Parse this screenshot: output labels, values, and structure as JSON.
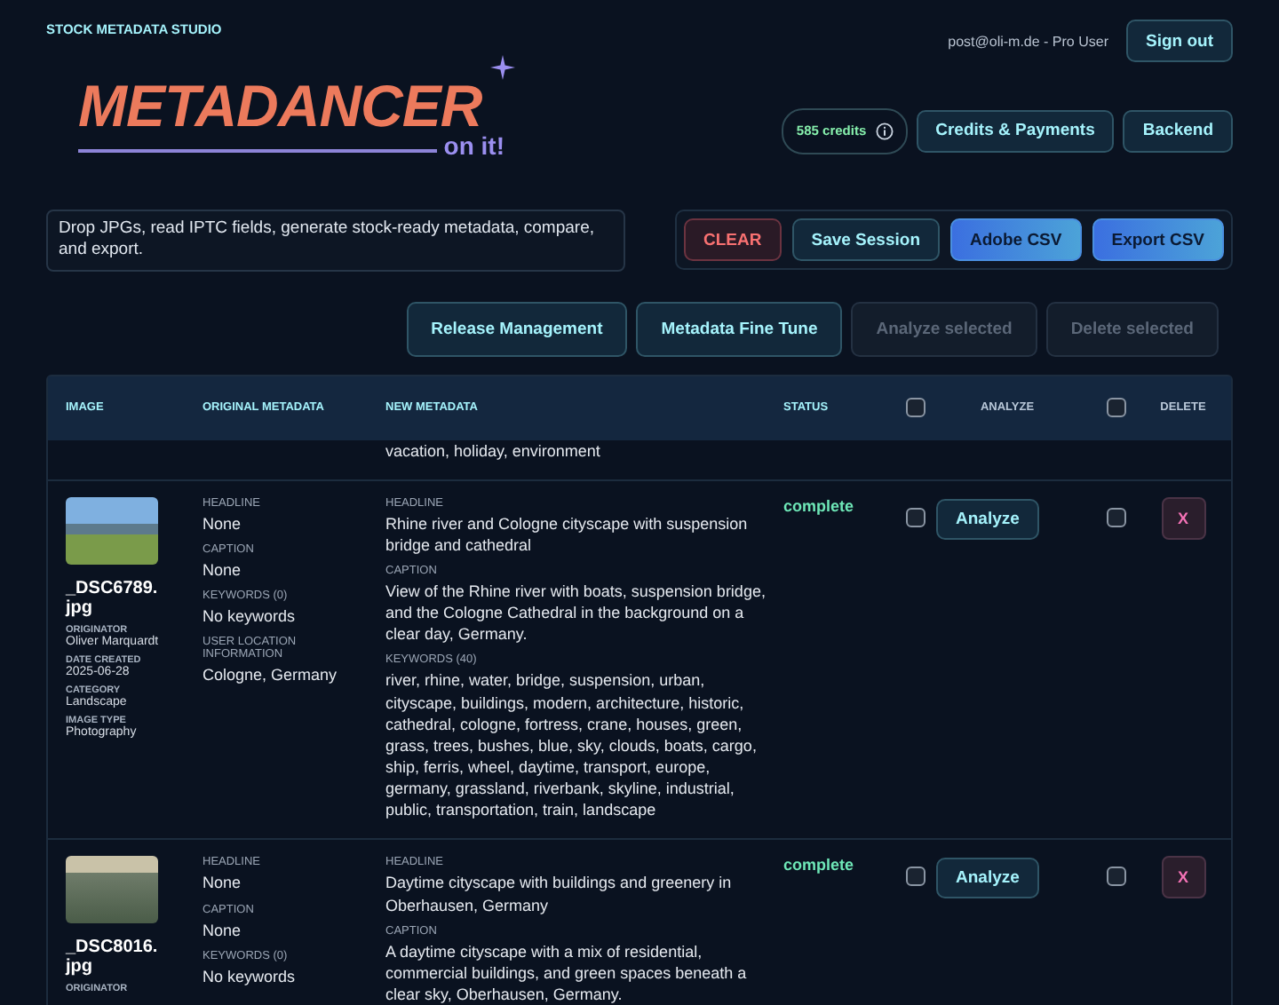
{
  "app_name": "STOCK METADATA STUDIO",
  "user": {
    "account": "post@oli-m.de - Pro User",
    "sign_out": "Sign out"
  },
  "logo": {
    "title": "METADANCER",
    "tagline": "on it!"
  },
  "credits": "585 credits",
  "nav_buttons": [
    "Credits & Payments",
    "Backend"
  ],
  "description": "Drop JPGs, read IPTC fields, generate stock-ready metadata, compare, and export.",
  "session_buttons": [
    {
      "label": "CLEAR",
      "kind": "danger"
    },
    {
      "label": "Save Session",
      "kind": "secondary"
    },
    {
      "label": "Adobe CSV",
      "kind": "primary"
    },
    {
      "label": "Export CSV",
      "kind": "primary"
    }
  ],
  "actions": [
    {
      "label": "Release Management",
      "disabled": false
    },
    {
      "label": "Metadata Fine Tune",
      "disabled": false
    },
    {
      "label": "Analyze selected",
      "disabled": true
    },
    {
      "label": "Delete selected",
      "disabled": true
    }
  ],
  "table": {
    "columns": [
      {
        "kind": "text",
        "label": "IMAGE"
      },
      {
        "kind": "text",
        "label": "ORIGINAL METADATA"
      },
      {
        "kind": "text",
        "label": "NEW METADATA"
      },
      {
        "kind": "text",
        "label": "STATUS"
      },
      {
        "kind": "checkbox",
        "checked": false
      },
      {
        "kind": "center",
        "label": "ANALYZE"
      },
      {
        "kind": "checkbox",
        "checked": false
      },
      {
        "kind": "center",
        "label": "DELETE"
      }
    ],
    "previous_row_tail": "vacation, holiday, environment",
    "rows": [
      {
        "filename": "_DSC6789.jpg",
        "image_details": [
          {
            "label": "ORIGINATOR",
            "value": "Oliver Marquardt"
          },
          {
            "label": "DATE CREATED",
            "value": "2025-06-28"
          },
          {
            "label": "CATEGORY",
            "value": "Landscape"
          },
          {
            "label": "IMAGE TYPE",
            "value": "Photography"
          }
        ],
        "original": [
          {
            "label": "HEADLINE",
            "value": "None"
          },
          {
            "label": "CAPTION",
            "value": "None"
          },
          {
            "label": "KEYWORDS (0)",
            "value": "No keywords"
          },
          {
            "label": "USER LOCATION INFORMATION",
            "value": "Cologne, Germany"
          }
        ],
        "new": [
          {
            "label": "HEADLINE",
            "value": "Rhine river and Cologne cityscape with suspension bridge and cathedral"
          },
          {
            "label": "CAPTION",
            "value": "View of the Rhine river with boats, suspension bridge, and the Cologne Cathedral in the background on a clear day, Germany."
          },
          {
            "label": "KEYWORDS (40)",
            "value": "river, rhine, water, bridge, suspension, urban, cityscape, buildings, modern, architecture, historic, cathedral, cologne, fortress, crane, houses, green, grass, trees, bushes, blue, sky, clouds, boats, cargo, ship, ferris, wheel, daytime, transport, europe, germany, grassland, riverbank, skyline, industrial, public, transportation, train, landscape"
          }
        ],
        "status": "complete",
        "analyze_checked": false,
        "analyze_label": "Analyze",
        "delete_checked": false,
        "delete_label": "X"
      },
      {
        "filename": "_DSC8016.jpg",
        "image_details": [
          {
            "label": "ORIGINATOR"
          }
        ],
        "original": [
          {
            "label": "HEADLINE",
            "value": "None"
          },
          {
            "label": "CAPTION",
            "value": "None"
          },
          {
            "label": "KEYWORDS (0)",
            "value": "No keywords"
          }
        ],
        "new": [
          {
            "label": "HEADLINE",
            "value": "Daytime cityscape with buildings and greenery in Oberhausen, Germany"
          },
          {
            "label": "CAPTION",
            "value": "A daytime cityscape with a mix of residential, commercial buildings, and green spaces beneath a clear sky, Oberhausen, Germany."
          }
        ],
        "status": "complete",
        "analyze_checked": false,
        "analyze_label": "Analyze",
        "delete_checked": false,
        "delete_label": "X"
      }
    ]
  }
}
